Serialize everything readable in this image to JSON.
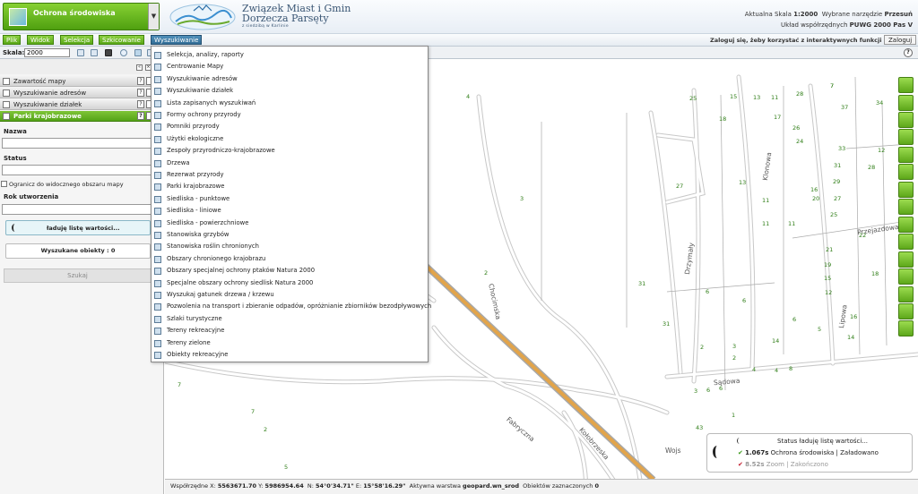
{
  "theme": {
    "label": "Ochrona środowiska"
  },
  "org": {
    "line1": "Związek Miast i Gmin",
    "line2": "Dorzecza Parsęty",
    "line3": "z siedzibą w Karlinie"
  },
  "header_right": {
    "scale_label": "Aktualna Skala",
    "scale_value": "1:2000",
    "tool_label": "Wybrane narzędzie",
    "tool_value": "Przesuń",
    "crs_label": "Układ współrzędnych",
    "crs_value": "PUWG 2000 Pas V"
  },
  "menu": [
    "Plik",
    "Widok",
    "Selekcja",
    "Szkicowanie",
    "Wyszukiwanie"
  ],
  "menu_active": 4,
  "login": {
    "message": "Zaloguj się, żeby korzystać z interaktywnych funkcji aplikacji",
    "button": "Zaloguj"
  },
  "scalebar": {
    "label": "Skala:",
    "value": "2000"
  },
  "sidebar": {
    "sections": [
      {
        "label": "Zawartość mapy"
      },
      {
        "label": "Wyszukiwanie adresów"
      },
      {
        "label": "Wyszukiwanie działek"
      },
      {
        "label": "Parki krajobrazowe"
      }
    ],
    "active_section": 3,
    "fields": {
      "nazwa": "Nazwa",
      "status": "Status",
      "rok": "Rok utworzenia"
    },
    "checkbox_label": "Ogranicz do widocznego obszaru mapy",
    "loading_text": "ładuję listę wartości...",
    "found_text": "Wyszukane obiekty : 0",
    "search_button": "Szukaj"
  },
  "dropdown_items": [
    "Selekcja, analizy, raporty",
    "Centrowanie Mapy",
    "Wyszukiwanie adresów",
    "Wyszukiwanie działek",
    "Lista zapisanych wyszukiwań",
    "Formy ochrony przyrody",
    "Pomniki przyrody",
    "Użytki ekologiczne",
    "Zespoły przyrodniczo-krajobrazowe",
    "Drzewa",
    "Rezerwat przyrody",
    "Parki krajobrazowe",
    "Siedliska - punktowe",
    "Siedliska - liniowe",
    "Siedliska - powierzchniowe",
    "Stanowiska grzybów",
    "Stanowiska roślin chronionych",
    "Obszary chronionego krajobrazu",
    "Obszary specjalnej ochrony ptaków Natura 2000",
    "Specjalne obszary ochrony siedlisk Natura 2000",
    "Wyszukaj gatunek drzewa / krzewu",
    "Pozwolenia na transport i zbieranie odpadów, opróżnianie zbiorników bezodpływowych",
    "Szlaki turystyczne",
    "Tereny rekreacyjne",
    "Tereny zielone",
    "Obiekty rekreacyjne"
  ],
  "map": {
    "streets": [
      "Chocimska",
      "Drzymały",
      "Klonowa",
      "Lipowa",
      "Przejazdowa",
      "Sądowa",
      "Fabryczna",
      "Kołobrzeska",
      "Wojs"
    ],
    "points": [
      "4",
      "3",
      "27",
      "2",
      "31",
      "6",
      "31",
      "2",
      "3",
      "25",
      "18",
      "15",
      "13",
      "11",
      "28",
      "7",
      "37",
      "34",
      "17",
      "26",
      "24",
      "33",
      "31",
      "28",
      "29",
      "16",
      "27",
      "20",
      "25",
      "13",
      "11",
      "22",
      "21",
      "19",
      "15",
      "12",
      "18",
      "14",
      "16",
      "7",
      "12",
      "11",
      "11",
      "6",
      "14",
      "2",
      "4",
      "8",
      "6",
      "5",
      "4",
      "3",
      "6",
      "6",
      "1",
      "7",
      "2",
      "7",
      "5",
      "8",
      "43",
      "1"
    ],
    "point_color": "#2e7d16"
  },
  "status_panel": {
    "row1_label": "Status",
    "row1_value": "ładuję listę wartości...",
    "row2_time": "1.067s",
    "row2_layer": "Ochrona środowiska",
    "row2_state": "Załadowano",
    "row3_time": "8.52s",
    "row3_action": "Zoom",
    "row3_state": "Zakończono"
  },
  "coords": {
    "x_label": "Współrzędne X:",
    "x_value": "5563671.70",
    "y_label": "Y:",
    "y_value": "5986954.64",
    "n_label": "N:",
    "n_value": "54°0'34.71\"",
    "e_label": "E:",
    "e_value": "15°58'16.29\"",
    "layer_label": "Aktywna warstwa",
    "layer_value": "geopard.wn_srod",
    "sel_label": "Obiektów zaznaczonych",
    "sel_value": "0"
  }
}
